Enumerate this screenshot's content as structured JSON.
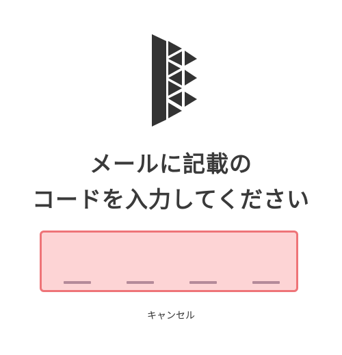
{
  "title": {
    "line1": "メールに記載の",
    "line2": "コードを入力してください"
  },
  "code_input": {
    "slots": [
      "",
      "",
      "",
      ""
    ],
    "colors": {
      "background": "#fdd4d5",
      "border": "#ee7478",
      "slot_underline": "#b48a99"
    }
  },
  "cancel_label": "キャンセル",
  "logo": {
    "icon": "brand-logo-icon",
    "color": "#333333"
  }
}
